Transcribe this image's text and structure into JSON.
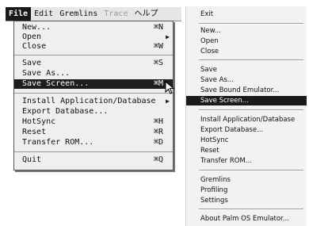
{
  "mac_menubar": {
    "items": [
      "File",
      "Edit",
      "Gremlins",
      "Trace",
      "ヘルプ"
    ]
  },
  "mac_menu": {
    "new": {
      "label": "New...",
      "shortcut": "⌘N"
    },
    "open": {
      "label": "Open"
    },
    "close": {
      "label": "Close",
      "shortcut": "⌘W"
    },
    "save": {
      "label": "Save",
      "shortcut": "⌘S"
    },
    "save_as": {
      "label": "Save As..."
    },
    "save_screen": {
      "label": "Save Screen...",
      "shortcut": "⌘M"
    },
    "install": {
      "label": "Install Application/Database"
    },
    "export": {
      "label": "Export Database..."
    },
    "hotsync": {
      "label": "HotSync",
      "shortcut": "⌘H"
    },
    "reset": {
      "label": "Reset",
      "shortcut": "⌘R"
    },
    "transfer": {
      "label": "Transfer ROM...",
      "shortcut": "⌘D"
    },
    "quit": {
      "label": "Quit",
      "shortcut": "⌘Q"
    }
  },
  "win_menu": {
    "exit": "Exit",
    "new": "New...",
    "open": "Open",
    "close": "Close",
    "save": "Save",
    "save_as": "Save As...",
    "save_bound": "Save Bound Emulator...",
    "save_screen": "Save Screen...",
    "install": "Install Application/Database",
    "export": "Export Database...",
    "hotsync": "HotSync",
    "reset": "Reset",
    "transfer": "Transfer ROM...",
    "gremlins": "Gremlins",
    "profiling": "Profiling",
    "settings": "Settings",
    "about": "About Palm OS Emulator..."
  }
}
